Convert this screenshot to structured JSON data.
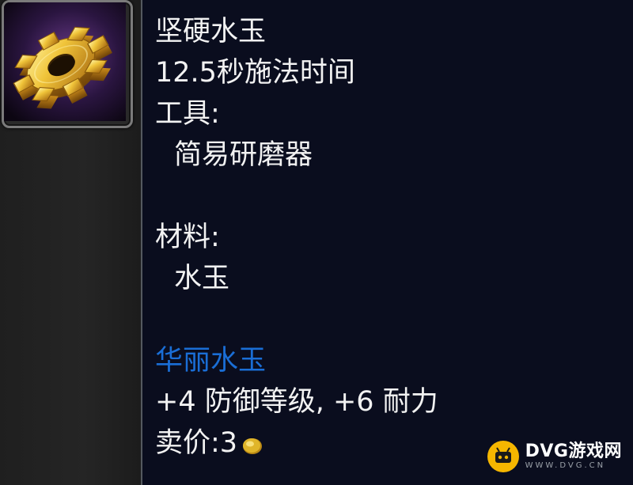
{
  "item": {
    "name": "坚硬水玉",
    "cast_time": "12.5秒施法时间",
    "tools_label": "工具:",
    "tool": "简易研磨器",
    "materials_label": "材料:",
    "material": "水玉",
    "result_name": "华丽水玉",
    "stats": "+4 防御等级, +6 耐力",
    "sell_label": "卖价:",
    "sell_value": "3"
  },
  "icon": {
    "name": "gear-icon"
  },
  "colors": {
    "tooltip_bg": "#0a0d1e",
    "text": "#f2f2f2",
    "result_name": "#1a6ed6",
    "coin": "#e0b52a"
  },
  "watermark": {
    "main": "DVG游戏网",
    "sub": "WWW.DVG.CN"
  }
}
